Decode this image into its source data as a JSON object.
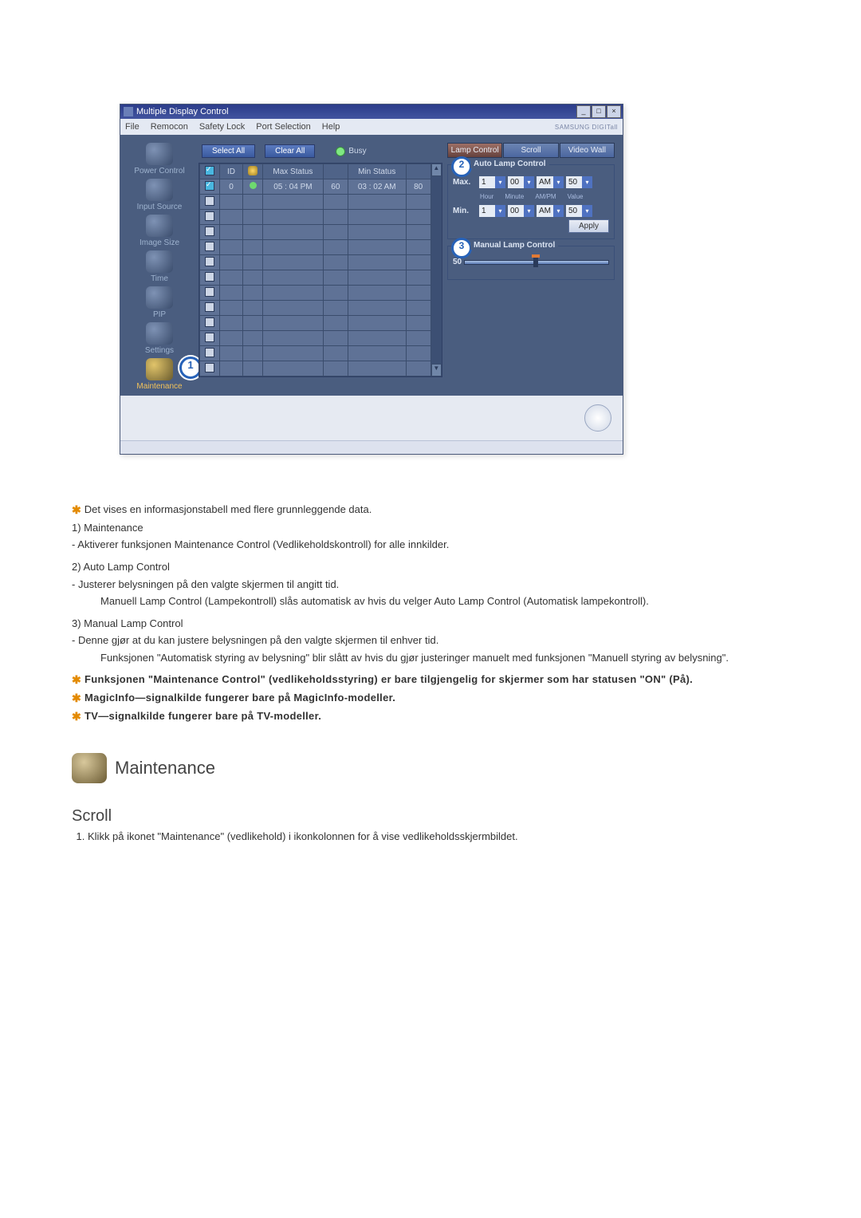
{
  "window": {
    "title": "Multiple Display Control",
    "menus": [
      "File",
      "Remocon",
      "Safety Lock",
      "Port Selection",
      "Help"
    ],
    "brand": "SAMSUNG DIGITall",
    "select_all": "Select All",
    "clear_all": "Clear All",
    "busy": "Busy"
  },
  "sidebar": {
    "items": [
      {
        "label": "Power Control"
      },
      {
        "label": "Input Source"
      },
      {
        "label": "Image Size"
      },
      {
        "label": "Time"
      },
      {
        "label": "PIP"
      },
      {
        "label": "Settings"
      },
      {
        "label": "Maintenance"
      }
    ]
  },
  "grid": {
    "headers": {
      "check": "☑",
      "id": "ID",
      "status": "",
      "max": "Max Status",
      "blank1": "",
      "min": "Min Status",
      "blank2": ""
    },
    "row0": {
      "id": "0",
      "max": "05 : 04 PM",
      "max_v": "60",
      "min": "03 : 02 AM",
      "min_v": "80"
    }
  },
  "badges": {
    "one": "1",
    "two": "2",
    "three": "3"
  },
  "tabs": {
    "lamp": "Lamp Control",
    "scroll": "Scroll",
    "video": "Video Wall"
  },
  "auto_lamp": {
    "title": "Auto Lamp Control",
    "max_label": "Max.",
    "min_label": "Min.",
    "hour": "1",
    "minute": "00",
    "ampm": "AM",
    "value": "50",
    "sub": {
      "hour": "Hour",
      "minute": "Minute",
      "ampm": "AM/PM",
      "value": "Value"
    },
    "apply": "Apply"
  },
  "manual_lamp": {
    "title": "Manual Lamp Control",
    "value": "50"
  },
  "doc": {
    "star1": "Det vises en informasjonstabell med flere grunnleggende data.",
    "item1_title": "1)  Maintenance",
    "item1_body": "- Aktiverer funksjonen Maintenance Control (Vedlikeholdskontroll) for alle innkilder.",
    "item2_title": "2)  Auto Lamp Control",
    "item2_body1": "- Justerer belysningen på den valgte skjermen til angitt tid.",
    "item2_body2": "Manuell Lamp Control (Lampekontroll) slås automatisk av hvis du velger Auto Lamp Control (Automatisk lampekontroll).",
    "item3_title": "3)  Manual Lamp Control",
    "item3_body1": "- Denne gjør at du kan justere belysningen på den valgte skjermen til enhver tid.",
    "item3_body2": "Funksjonen \"Automatisk styring av belysning\" blir slått av hvis du gjør justeringer manuelt med funksjonen \"Manuell styring av belysning\".",
    "star2": "Funksjonen \"Maintenance Control\" (vedlikeholdsstyring) er bare tilgjengelig for skjermer som har statusen \"ON\" (På).",
    "star3": "MagicInfo—signalkilde fungerer bare på MagicInfo-modeller.",
    "star4": "TV—signalkilde fungerer bare på TV-modeller.",
    "section_heading": "Maintenance",
    "subsection_heading": "Scroll",
    "step1": "Klikk på ikonet \"Maintenance\" (vedlikehold) i ikonkolonnen for å vise vedlikeholdsskjermbildet."
  }
}
